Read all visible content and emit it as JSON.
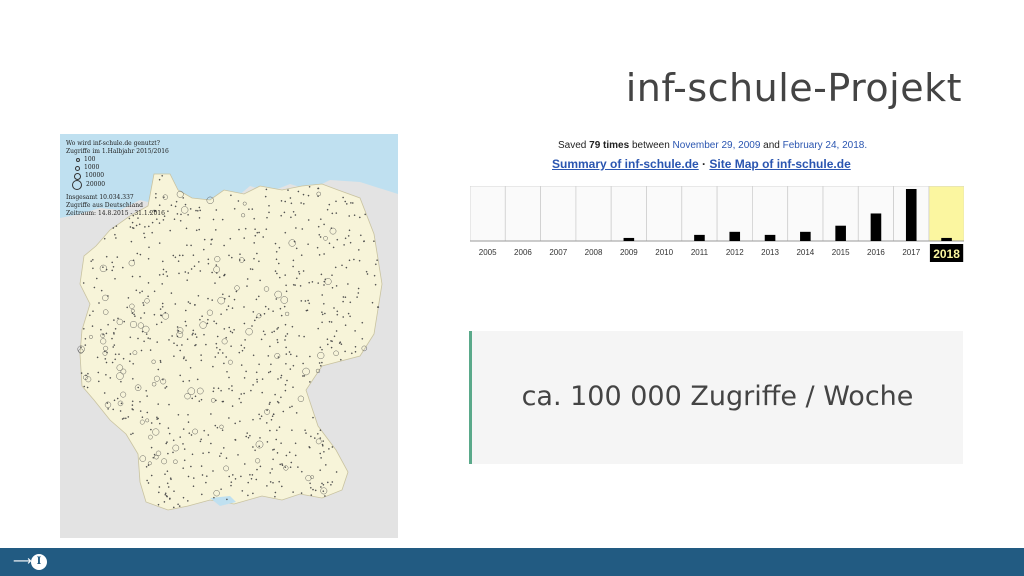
{
  "slide": {
    "title": "inf-schule-Projekt",
    "quote": "ca. 100 000 Zugriffe / Woche"
  },
  "map": {
    "legend_title": "Wo wird inf-schule.de genutzt?",
    "legend_subtitle": "Zugriffe im 1.Halbjahr 2015/2016",
    "legend_sizes": [
      "100",
      "1000",
      "10000",
      "20000"
    ],
    "total": "Insgesamt 10.034.337",
    "scope": "Zugriffe aus Deutschland",
    "period": "Zeitraum: 14.8.2015 - 31.1.2016",
    "colors": {
      "land": "#f7f4d9",
      "sea": "#bfe0f0",
      "neighbors": "#e3e3e3"
    }
  },
  "wayback": {
    "saved_prefix": "Saved",
    "saved_count": "79 times",
    "saved_between": "between",
    "date_start": "November 29, 2009",
    "and": "and",
    "date_end": "February 24, 2018.",
    "summary_link": "Summary of inf-schule.de",
    "separator": "·",
    "sitemap_link": "Site Map of inf-schule.de",
    "selected_year": "2018",
    "selected_color": "#fbf6a0",
    "chart_data": {
      "type": "bar",
      "categories": [
        "2005",
        "2006",
        "2007",
        "2008",
        "2009",
        "2010",
        "2011",
        "2012",
        "2013",
        "2014",
        "2015",
        "2016",
        "2017",
        "2018"
      ],
      "values": [
        0,
        0,
        0,
        0,
        1,
        0,
        2,
        3,
        2,
        3,
        5,
        9,
        17,
        1
      ],
      "xlabel": "",
      "ylabel": ""
    }
  },
  "footer": {
    "arrow": "⟶",
    "badge": "I",
    "bar_color": "#225b82"
  }
}
